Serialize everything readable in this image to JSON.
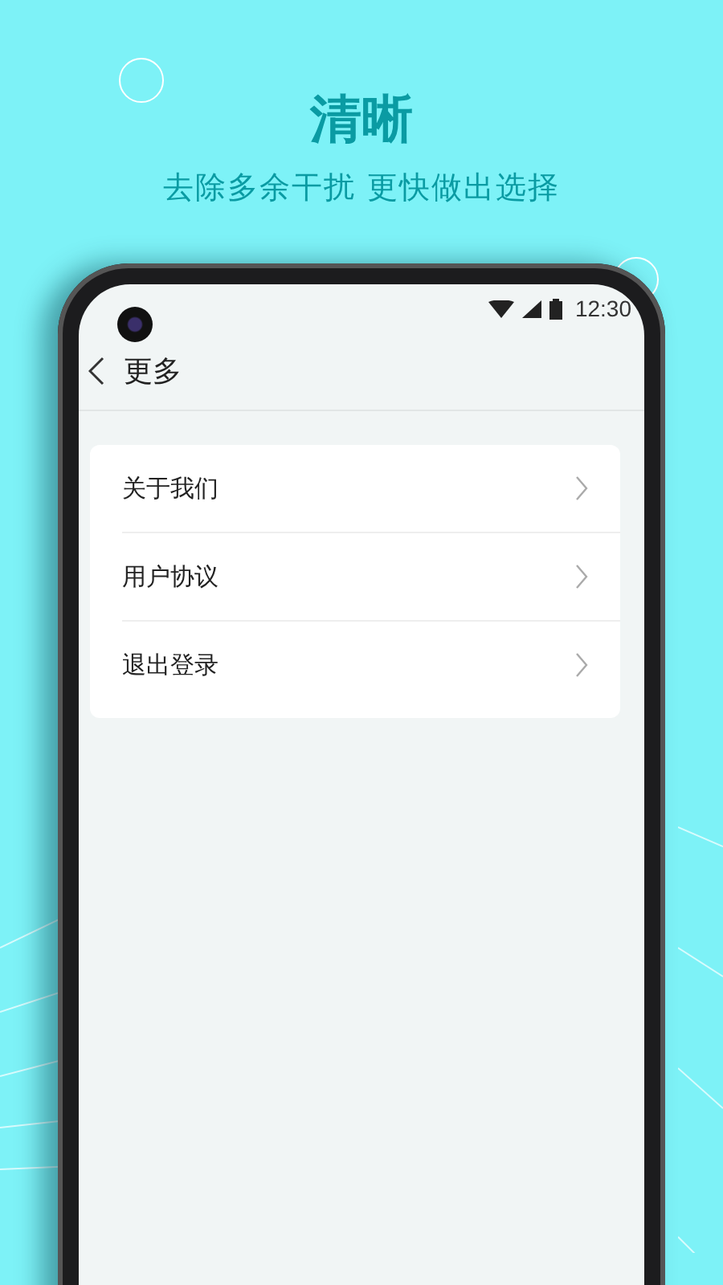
{
  "headline": "清晰",
  "subtitle": "去除多余干扰 更快做出选择",
  "status_bar": {
    "time": "12:30"
  },
  "nav": {
    "title": "更多"
  },
  "menu_items": [
    {
      "label": "关于我们"
    },
    {
      "label": "用户协议"
    },
    {
      "label": "退出登录"
    }
  ]
}
